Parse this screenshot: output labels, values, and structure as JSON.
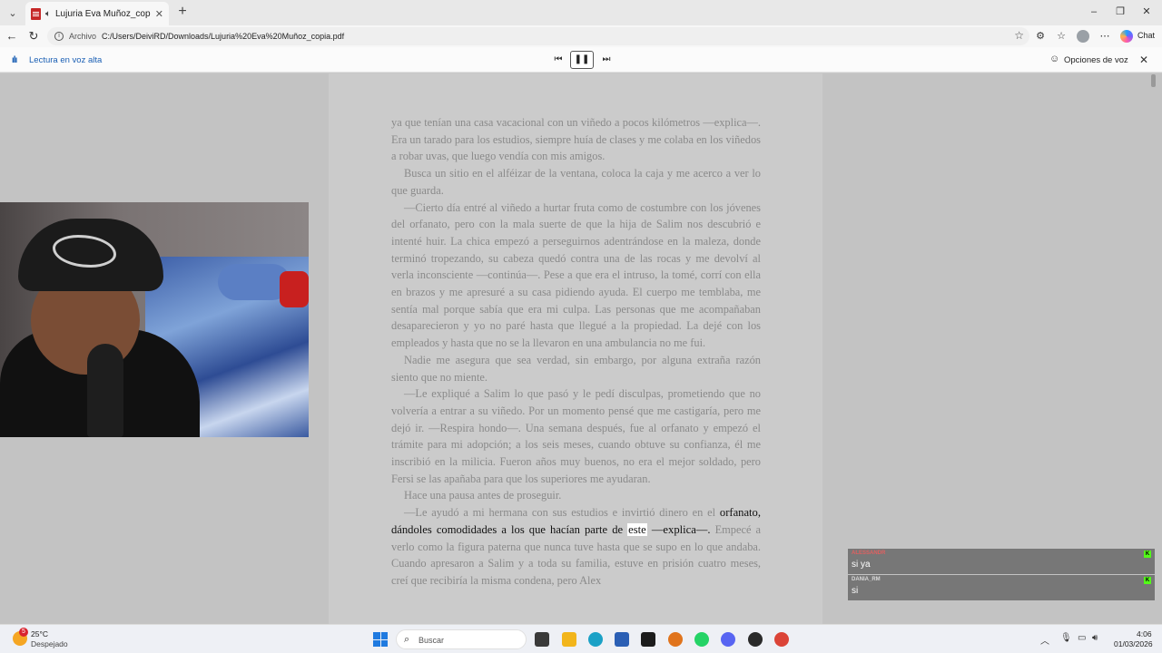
{
  "browser": {
    "tab": {
      "title": "Lujuria Eva Muñoz_copia.pdf"
    },
    "address": {
      "label": "Archivo",
      "url": "C:/Users/DeiviRD/Downloads/Lujuria%20Eva%20Muñoz_copia.pdf"
    },
    "chat_label": "Chat"
  },
  "read_aloud": {
    "label": "Lectura en voz alta",
    "voice_options_label": "Opciones de voz"
  },
  "document": {
    "paragraphs": [
      "ya que tenían una casa vacacional con un viñedo a pocos kilómetros —explica—. Era un tarado para los estudios, siempre huía de clases y me colaba en los viñedos a robar uvas, que luego vendía con mis amigos.",
      "Busca un sitio en el alféizar de la ventana, coloca la caja y me acerco a ver lo que guarda.",
      "—Cierto día entré al viñedo a hurtar fruta como de costumbre con los jóvenes del orfanato, pero con la mala suerte de que la hija de Salim nos descubrió e intenté huir. La chica empezó a perseguirnos adentrándose en la maleza, donde terminó tropezando, su cabeza quedó contra una de las rocas y me devolví al verla inconsciente —continúa—. Pese a que era el intruso, la tomé, corrí con ella en brazos y me apresuré a su casa pidiendo ayuda. El cuerpo me temblaba, me sentía mal porque sabía que era mi culpa. Las personas que me acompañaban desaparecieron y yo no paré hasta que llegué a la propiedad. La dejé con los empleados y hasta que no se la llevaron en una ambulancia no me fui.",
      "Nadie me asegura que sea verdad, sin embargo, por alguna extraña razón siento que no miente.",
      "—Le expliqué a Salim lo que pasó y le pedí disculpas, prometiendo que no volvería a entrar a su viñedo. Por un momento pensé que me castigaría, pero me dejó ir. —Respira hondo—. Una semana después, fue al orfanato y empezó el trámite para mi adopción; a los seis meses, cuando obtuve su confianza, él me inscribió en la milicia. Fueron años muy buenos, no era el mejor soldado, pero Fersi se las apañaba para que los superiores me ayudaran.",
      "Hace una pausa antes de proseguir."
    ],
    "para7_start": "—Le ayudó a mi hermana con sus estudios e invirtió dinero en el",
    "current_before": "orfanato, dándoles comodidades a los que hacían parte de ",
    "current_word": "este",
    "current_after": " —explica—.",
    "para7_rest": "Empecé a verlo como la figura paterna que nunca tuve hasta que se supo en lo que andaba. Cuando apresaron a Salim y a toda su familia, estuve en prisión cuatro meses, creí que recibiría la misma condena, pero Alex"
  },
  "chat_overlay": [
    {
      "user": "ALESSANDR",
      "text": "si ya"
    },
    {
      "user": "DANIA_RM",
      "text": "si"
    }
  ],
  "taskbar": {
    "weather": {
      "temp": "25°C",
      "condition": "Despejado",
      "badge": "5"
    },
    "search_placeholder": "Buscar",
    "clock": {
      "time": "4:06",
      "date": "01/03/2026"
    }
  },
  "colors": {
    "read_accent": "#1a5fb4",
    "highlight": "#ffffff",
    "dim_text": "#8a8a8a"
  },
  "icons": [
    "pdf-icon",
    "speaker-icon",
    "back-icon",
    "refresh-icon",
    "info-icon",
    "star-icon",
    "extensions-icon",
    "favorites-icon",
    "profile-avatar",
    "more-icon",
    "copilot-icon",
    "read-aloud-icon",
    "previous-icon",
    "pause-icon",
    "next-icon",
    "voice-options-icon",
    "close-icon",
    "windows-start-icon",
    "search-icon"
  ]
}
